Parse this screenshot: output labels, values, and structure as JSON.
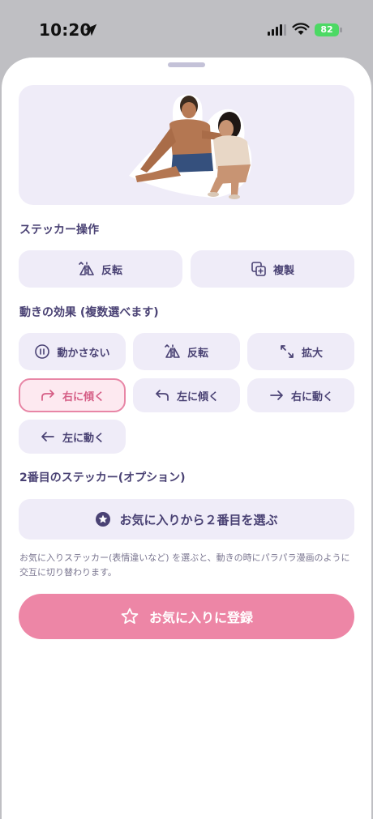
{
  "status_bar": {
    "time": "10:20",
    "battery": "82"
  },
  "sticker_ops": {
    "title": "ステッカー操作",
    "flip_label": "反転",
    "duplicate_label": "複製"
  },
  "effects": {
    "title": "動きの効果 (複数選べます)",
    "items": [
      {
        "label": "動かさない",
        "icon": "pause-icon",
        "selected": false
      },
      {
        "label": "反転",
        "icon": "flip-icon",
        "selected": false
      },
      {
        "label": "拡大",
        "icon": "expand-icon",
        "selected": false
      },
      {
        "label": "右に傾く",
        "icon": "redo-arrow-icon",
        "selected": true
      },
      {
        "label": "左に傾く",
        "icon": "undo-arrow-icon",
        "selected": false
      },
      {
        "label": "右に動く",
        "icon": "arrow-right-icon",
        "selected": false
      },
      {
        "label": "左に動く",
        "icon": "arrow-left-icon",
        "selected": false
      }
    ]
  },
  "second_sticker": {
    "title": "2番目のステッカー(オプション)",
    "choose_label": "お気に入りから２番目を選ぶ",
    "note": "お気に入りステッカー(表情違いなど) を選ぶと、動きの時にパラパラ漫画のように交互に切り替わります。"
  },
  "favorite_button": {
    "label": "お気に入りに登録"
  },
  "colors": {
    "accent_text": "#4a4274",
    "button_bg": "#efecf8",
    "selected_border": "#e886a6",
    "selected_text": "#d55d85",
    "primary_pink": "#ed86a6",
    "battery": "#4cd964"
  }
}
